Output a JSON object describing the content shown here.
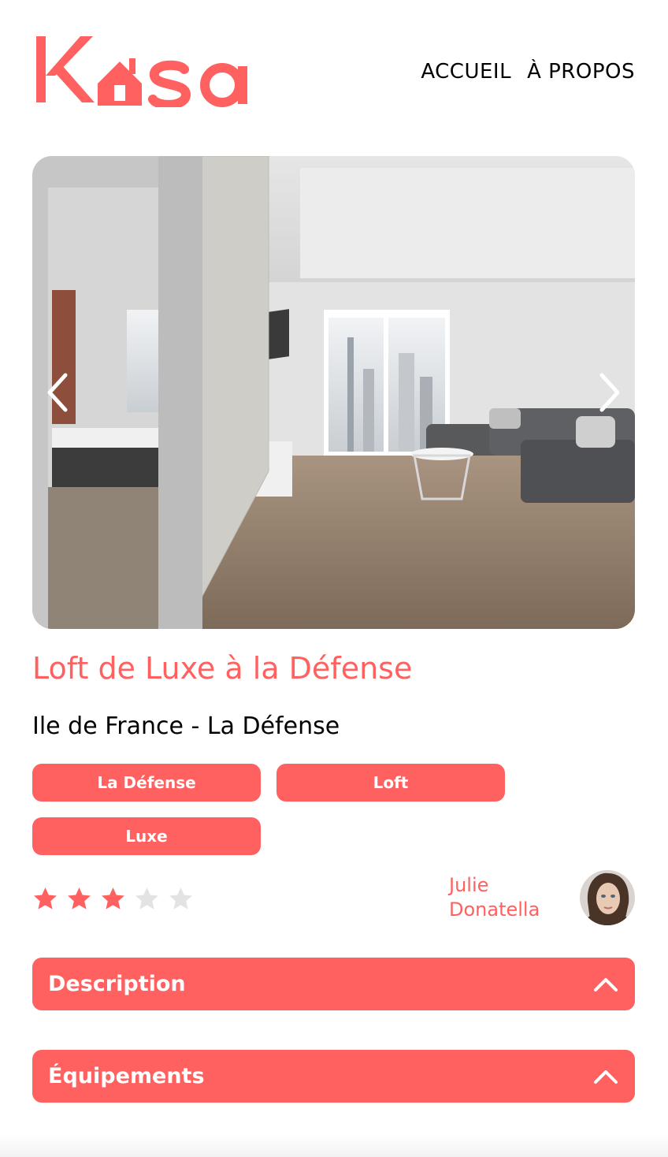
{
  "brand": {
    "name": "Kasa",
    "logo_icon": "house-icon",
    "accent": "#FF6060"
  },
  "nav": {
    "home": "ACCUEIL",
    "about": "À PROPOS"
  },
  "carousel": {
    "prev_icon": "chevron-left-icon",
    "next_icon": "chevron-right-icon"
  },
  "listing": {
    "title": "Loft de Luxe à la Défense",
    "location": "Ile de France - La Défense",
    "tags": [
      "La Défense",
      "Loft",
      "Luxe"
    ],
    "rating": 3,
    "rating_max": 5
  },
  "host": {
    "first_name": "Julie",
    "last_name": "Donatella"
  },
  "sections": {
    "description": "Description",
    "equipments": "Équipements"
  },
  "colors": {
    "accent": "#FF6060",
    "star_off": "#E3E3E3"
  }
}
